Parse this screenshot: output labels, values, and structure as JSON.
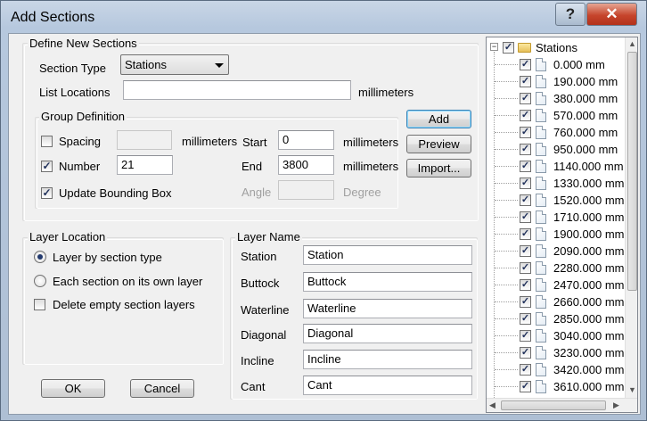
{
  "window": {
    "title": "Add Sections",
    "help_label": "?",
    "close_label": "✕"
  },
  "define": {
    "legend": "Define New Sections",
    "section_type_label": "Section Type",
    "section_type_value": "Stations",
    "list_locations_label": "List Locations",
    "list_locations_value": "",
    "list_units": "millimeters"
  },
  "group": {
    "legend": "Group Definition",
    "spacing_label": "Spacing",
    "spacing_value": "",
    "spacing_units": "millimeters",
    "number_label": "Number",
    "number_value": "21",
    "update_bbox_label": "Update Bounding Box",
    "start_label": "Start",
    "start_value": "0",
    "start_units": "millimeters",
    "end_label": "End",
    "end_value": "3800",
    "end_units": "millimeters",
    "angle_label": "Angle",
    "angle_value": "",
    "angle_units": "Degree",
    "spacing_checked": false,
    "number_checked": true,
    "update_bbox_checked": true
  },
  "actions": {
    "add": "Add",
    "preview": "Preview",
    "import": "Import..."
  },
  "layer_location": {
    "legend": "Layer Location",
    "options": [
      "Layer by section type",
      "Each section on its own layer"
    ],
    "selected_index": 0,
    "delete_empty_label": "Delete empty section layers",
    "delete_empty_checked": false
  },
  "layer_name": {
    "legend": "Layer Name",
    "rows": [
      {
        "label": "Station",
        "value": "Station"
      },
      {
        "label": "Buttock",
        "value": "Buttock"
      },
      {
        "label": "Waterline",
        "value": "Waterline"
      },
      {
        "label": "Diagonal",
        "value": "Diagonal"
      },
      {
        "label": "Incline",
        "value": "Incline"
      },
      {
        "label": "Cant",
        "value": "Cant"
      }
    ]
  },
  "footer": {
    "ok": "OK",
    "cancel": "Cancel"
  },
  "tree": {
    "root": "Stations",
    "items": [
      "0.000 mm",
      "190.000 mm",
      "380.000 mm",
      "570.000 mm",
      "760.000 mm",
      "950.000 mm",
      "1140.000 mm",
      "1330.000 mm",
      "1520.000 mm",
      "1710.000 mm",
      "1900.000 mm",
      "2090.000 mm",
      "2280.000 mm",
      "2470.000 mm",
      "2660.000 mm",
      "2850.000 mm",
      "3040.000 mm",
      "3230.000 mm",
      "3420.000 mm",
      "3610.000 mm"
    ]
  }
}
